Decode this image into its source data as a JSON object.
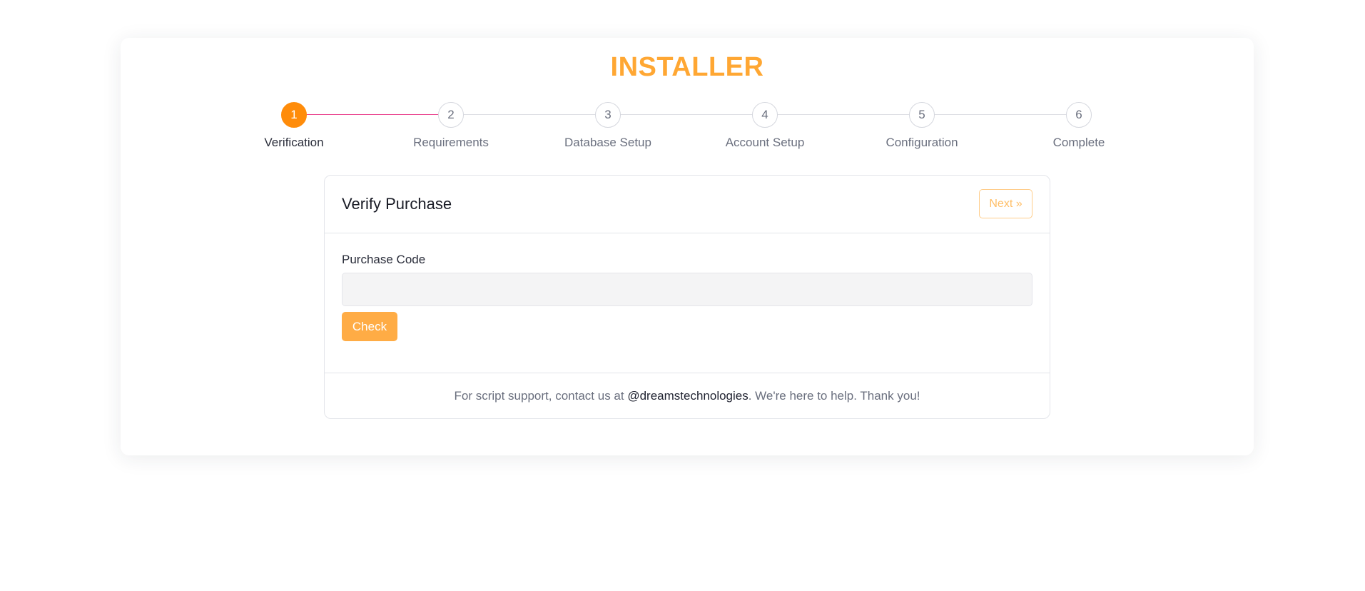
{
  "installer": {
    "title": "INSTALLER"
  },
  "steps": [
    {
      "number": "1",
      "label": "Verification",
      "active": true
    },
    {
      "number": "2",
      "label": "Requirements",
      "active": false
    },
    {
      "number": "3",
      "label": "Database Setup",
      "active": false
    },
    {
      "number": "4",
      "label": "Account Setup",
      "active": false
    },
    {
      "number": "5",
      "label": "Configuration",
      "active": false
    },
    {
      "number": "6",
      "label": "Complete",
      "active": false
    }
  ],
  "card": {
    "title": "Verify Purchase",
    "next_label": "Next »",
    "field_label": "Purchase Code",
    "input_value": "",
    "input_placeholder": "",
    "check_label": "Check"
  },
  "footer": {
    "text_before": "For script support, contact us at ",
    "link_text": "@dreamstechnologies",
    "text_after": ". We're here to help. Thank you!"
  },
  "colors": {
    "accent": "#ffa733",
    "active_step": "#ff8c0a",
    "progress_line": "#e9408c",
    "check_button": "#ffac45"
  }
}
